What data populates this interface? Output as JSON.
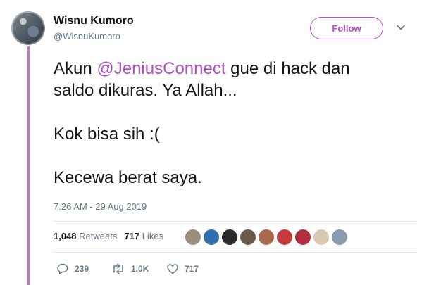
{
  "user": {
    "name": "Wisnu Kumoro",
    "handle": "@WisnuKumoro"
  },
  "follow_label": "Follow",
  "tweet": {
    "line1_pre": "Akun ",
    "mention": "@JeniusConnect",
    "line1_post": " gue di hack dan",
    "line2": "saldo dikuras. Ya Allah...",
    "line3": "Kok bisa sih :(",
    "line4": "Kecewa berat saya."
  },
  "timestamp": "7:26 AM - 29 Aug 2019",
  "stats": {
    "retweets_count": "1,048",
    "retweets_label": "Retweets",
    "likes_count": "717",
    "likes_label": "Likes"
  },
  "likers_colors": [
    "#9a8f7a",
    "#2f6fb0",
    "#2b2b2b",
    "#6b5a4a",
    "#a86a4a",
    "#c53a3a",
    "#b03040",
    "#d9c9b0",
    "#8a9bb0"
  ],
  "actions": {
    "replies": "239",
    "retweets": "1.0K",
    "likes": "717"
  },
  "colors": {
    "accent": "#b14fc8",
    "bar": "#c56fd7",
    "muted": "#657786"
  }
}
